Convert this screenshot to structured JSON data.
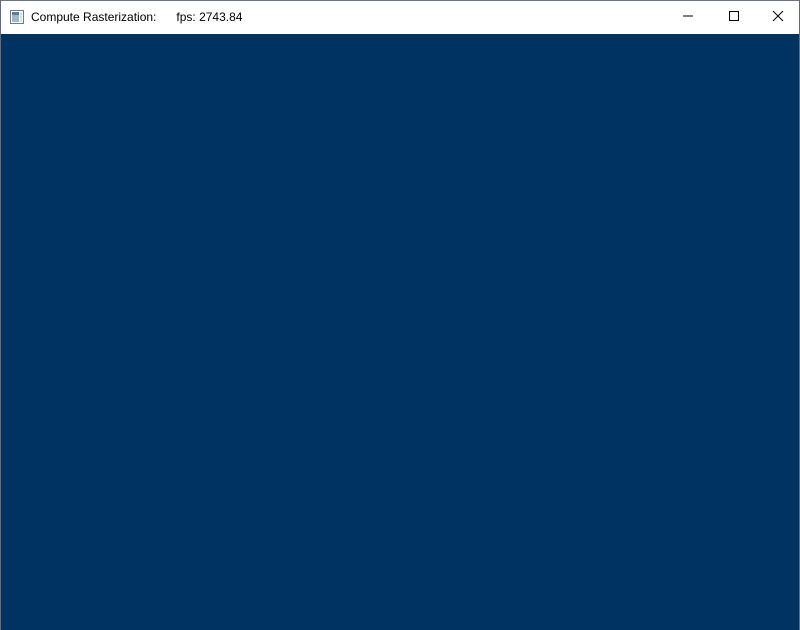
{
  "window": {
    "title": "Compute Rasterization:      fps: 2743.84",
    "icon": "app-window-icon",
    "controls": {
      "minimize_icon": "minimize-icon",
      "maximize_icon": "maximize-icon",
      "close_icon": "close-icon"
    }
  },
  "colors": {
    "titlebar_bg": "#ffffff",
    "client_bg": "#003262",
    "title_text": "#000000"
  }
}
